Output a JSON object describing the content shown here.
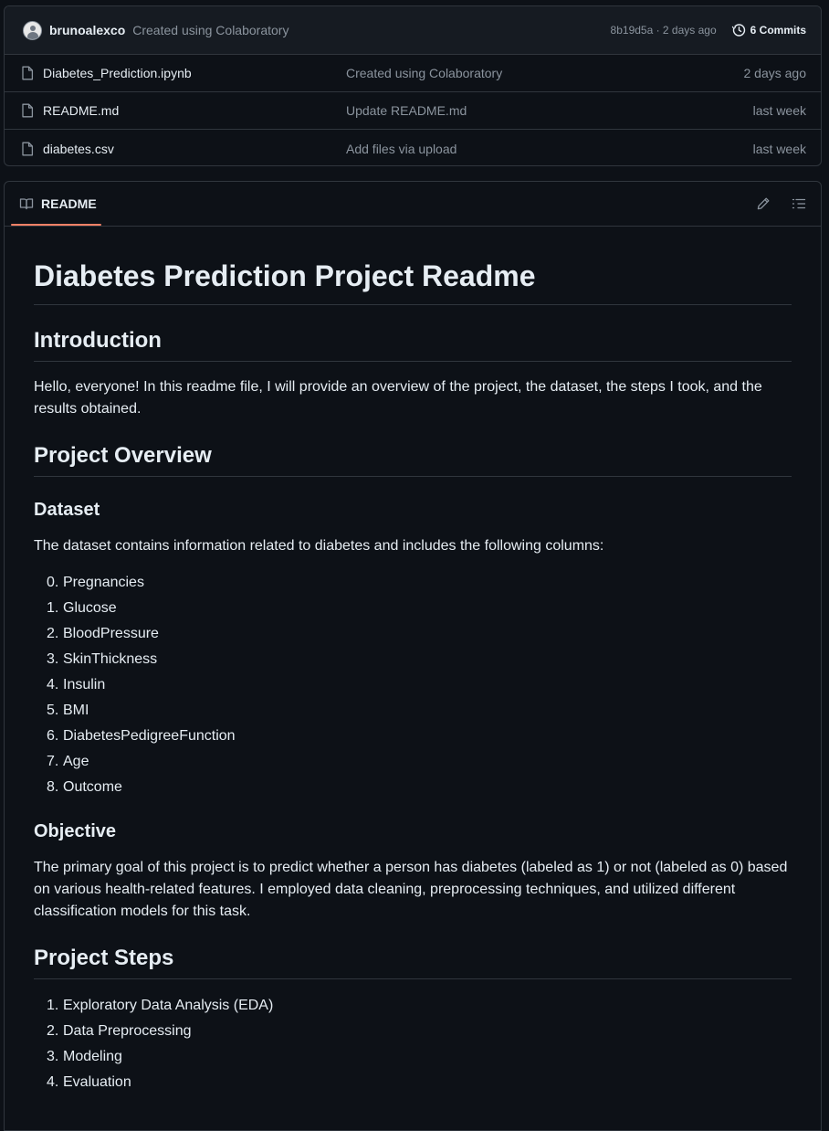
{
  "commit_bar": {
    "author": "brunoalexco",
    "message": "Created using Colaboratory",
    "sha_time": "8b19d5a · 2 days ago",
    "commits_label": "6 Commits"
  },
  "files": [
    {
      "name": "Diabetes_Prediction.ipynb",
      "message": "Created using Colaboratory",
      "date": "2 days ago"
    },
    {
      "name": "README.md",
      "message": "Update README.md",
      "date": "last week"
    },
    {
      "name": "diabetes.csv",
      "message": "Add files via upload",
      "date": "last week"
    }
  ],
  "readme_header": {
    "tab_label": "README",
    "icons": [
      "book-icon",
      "pencil-icon",
      "list-icon"
    ]
  },
  "readme": {
    "title": "Diabetes Prediction Project Readme",
    "intro_heading": "Introduction",
    "intro_text": "Hello, everyone! In this readme file, I will provide an overview of the project, the dataset, the steps I took, and the results obtained.",
    "overview_heading": "Project Overview",
    "dataset_heading": "Dataset",
    "dataset_text": "The dataset contains information related to diabetes and includes the following columns:",
    "columns": [
      {
        "n": "0.",
        "label": "Pregnancies"
      },
      {
        "n": "1.",
        "label": "Glucose"
      },
      {
        "n": "2.",
        "label": "BloodPressure"
      },
      {
        "n": "3.",
        "label": "SkinThickness"
      },
      {
        "n": "4.",
        "label": "Insulin"
      },
      {
        "n": "5.",
        "label": "BMI"
      },
      {
        "n": "6.",
        "label": "DiabetesPedigreeFunction"
      },
      {
        "n": "7.",
        "label": "Age"
      },
      {
        "n": "8.",
        "label": "Outcome"
      }
    ],
    "objective_heading": "Objective",
    "objective_text": "The primary goal of this project is to predict whether a person has diabetes (labeled as 1) or not (labeled as 0) based on various health-related features. I employed data cleaning, preprocessing techniques, and utilized different classification models for this task.",
    "steps_heading": "Project Steps",
    "steps": [
      {
        "n": "1.",
        "label": "Exploratory Data Analysis (EDA)"
      },
      {
        "n": "2.",
        "label": "Data Preprocessing"
      },
      {
        "n": "3.",
        "label": "Modeling"
      },
      {
        "n": "4.",
        "label": "Evaluation"
      }
    ]
  },
  "colors": {
    "background": "#0d1117",
    "border": "#30363d",
    "text": "#e6edf3",
    "muted": "#8b949e",
    "tab_accent": "#f78166"
  }
}
